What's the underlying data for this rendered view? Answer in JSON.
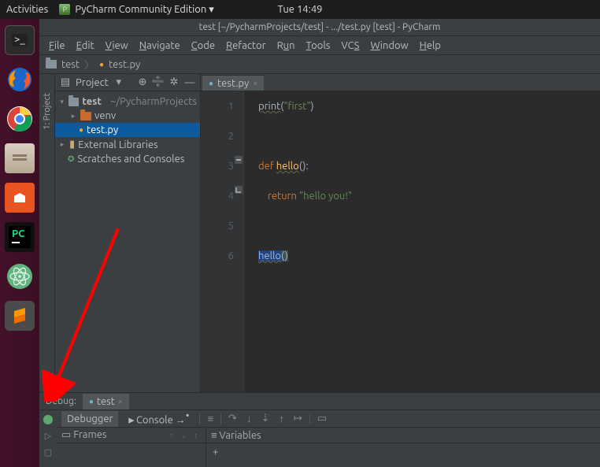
{
  "ubuntu_bar": {
    "activities": "Activities",
    "app_name": "PyCharm Community Edition ▾",
    "clock": "Tue 14:49"
  },
  "titlebar": "test [~/PycharmProjects/test] - .../test.py [test] - PyCharm",
  "menubar": [
    "File",
    "Edit",
    "View",
    "Navigate",
    "Code",
    "Refactor",
    "Run",
    "Tools",
    "VCS",
    "Window",
    "Help"
  ],
  "breadcrumb": {
    "project": "test",
    "file": "test.py"
  },
  "left_strip": {
    "project_label": "1: Project"
  },
  "project_panel": {
    "header": {
      "title": "Project"
    },
    "tree": {
      "root": {
        "name": "test",
        "path": "~/PycharmProjects"
      },
      "venv": "venv",
      "file": "test.py",
      "ext_libs": "External Libraries",
      "scratches": "Scratches and Consoles"
    }
  },
  "editor_tab": {
    "name": "test.py"
  },
  "code_lines": {
    "l1_print": "print",
    "l1_open": "(",
    "l1_str": "\"first\"",
    "l1_close": ")",
    "l3_def": "def ",
    "l3_name": "hello",
    "l3_rest": "():",
    "l4_indent": "    ",
    "l4_return": "return ",
    "l4_str": "\"hello you!\"",
    "l6_call": "hello",
    "l6_open": "(",
    "l6_close": ")"
  },
  "gutter": {
    "n1": "1",
    "n2": "2",
    "n3": "3",
    "n4": "4",
    "n5": "5",
    "n6": "6"
  },
  "debug": {
    "label": "Debug:",
    "run_config": "test",
    "tabs": {
      "debugger": "Debugger",
      "console": "Console"
    },
    "frames_title": "Frames",
    "vars_title": "Variables",
    "plus": "+"
  }
}
